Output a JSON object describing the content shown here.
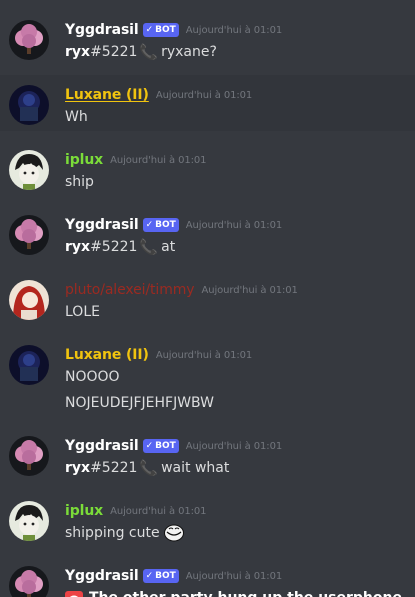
{
  "colors": {
    "background": "#36393f",
    "hover_row": "#32353b",
    "text": "#dcddde",
    "timestamp": "#72767d",
    "bot_badge": "#5865f2",
    "yggdrasil": "#ffffff",
    "luxane": "#f1c40f",
    "iplux": "#7bdc39",
    "pluto": "#9b2a21"
  },
  "bot_badge_label": "BOT",
  "messages": [
    {
      "author": "Yggdrasil",
      "bot": true,
      "timestamp": "Aujourd'hui à 01:01",
      "user": "ryx",
      "discrim": "#5221",
      "text": "ryxane?",
      "avatar": "tree-avatar"
    },
    {
      "author": "Luxane (II)",
      "bot": false,
      "timestamp": "Aujourd'hui à 01:01",
      "text": "Wh",
      "avatar": "dark-avatar"
    },
    {
      "author": "iplux",
      "bot": false,
      "timestamp": "Aujourd'hui à 01:01",
      "text": "ship",
      "avatar": "boy-avatar"
    },
    {
      "author": "Yggdrasil",
      "bot": true,
      "timestamp": "Aujourd'hui à 01:01",
      "user": "ryx",
      "discrim": "#5221",
      "text": "at",
      "avatar": "tree-avatar"
    },
    {
      "author": "pluto/alexei/timmy",
      "bot": false,
      "timestamp": "Aujourd'hui à 01:01",
      "text": "LOLE",
      "avatar": "red-hair-avatar"
    },
    {
      "author": "Luxane (II)",
      "bot": false,
      "timestamp": "Aujourd'hui à 01:01",
      "text": "NOOOO",
      "text2": "NOJEUDEJFJEHFJWBW",
      "avatar": "dark-avatar"
    },
    {
      "author": "Yggdrasil",
      "bot": true,
      "timestamp": "Aujourd'hui à 01:01",
      "user": "ryx",
      "discrim": "#5221",
      "text": "wait what",
      "avatar": "tree-avatar"
    },
    {
      "author": "iplux",
      "bot": false,
      "timestamp": "Aujourd'hui à 01:01",
      "text": "shipping cute",
      "emoji": "trollface-emoji",
      "avatar": "boy-avatar"
    },
    {
      "author": "Yggdrasil",
      "bot": true,
      "timestamp": "Aujourd'hui à 01:01",
      "text": "The other party hung up the userphone",
      "icon": "hangup-phone-icon",
      "avatar": "tree-avatar"
    }
  ]
}
